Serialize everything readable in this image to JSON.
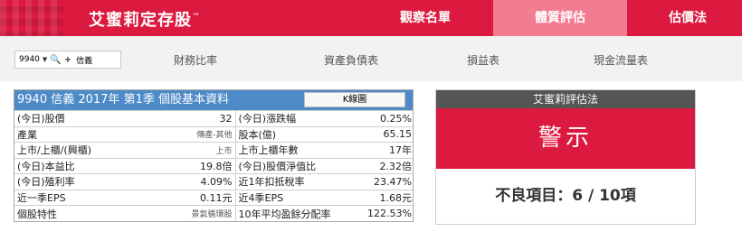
{
  "header": {
    "brand": "艾蜜莉定存股",
    "brand_mark": "™",
    "nav": [
      {
        "label": "觀察名單"
      },
      {
        "label": "體質評估"
      },
      {
        "label": "估價法"
      }
    ],
    "colors": {
      "primary": "#dc1a3f",
      "active_tab": "#f27d92"
    }
  },
  "toolbar": {
    "stock_code": "9940",
    "stock_name": "信義",
    "dropdown_icon": "chevron-down-icon",
    "search_icon": "search-icon",
    "add_icon": "plus-icon",
    "tabs": [
      {
        "label": "財務比率"
      },
      {
        "label": "資產負債表"
      },
      {
        "label": "損益表"
      },
      {
        "label": "現金流量表"
      }
    ]
  },
  "info": {
    "title": "9940 信義 2017年 第1季 個股基本資料",
    "kline_button": "K線圖",
    "rows": [
      {
        "l1": "(今日)股價",
        "v1": "32",
        "l2": "(今日)漲跌幅",
        "v2": "0.25%"
      },
      {
        "l1": "產業",
        "v1": "傳產-其他",
        "l2": "股本(億)",
        "v2": "65.15"
      },
      {
        "l1": "上市/上櫃/(興櫃)",
        "v1": "上市",
        "l2": "上市上櫃年數",
        "v2": "17年"
      },
      {
        "l1": "(今日)本益比",
        "v1": "19.8倍",
        "l2": "(今日)股價淨值比",
        "v2": "2.32倍"
      },
      {
        "l1": "(今日)殖利率",
        "v1": "4.09%",
        "l2": "近1年扣抵稅率",
        "v2": "23.47%"
      },
      {
        "l1": "近一季EPS",
        "v1": "0.11元",
        "l2": "近4季EPS",
        "v2": "1.68元"
      },
      {
        "l1": "個股特性",
        "v1": "景氣循環股",
        "l2": "10年平均盈餘分配率",
        "v2": "122.53%"
      }
    ]
  },
  "evaluation": {
    "title": "艾蜜莉評估法",
    "status": "警示",
    "summary": "不良項目：6 / 10項"
  }
}
